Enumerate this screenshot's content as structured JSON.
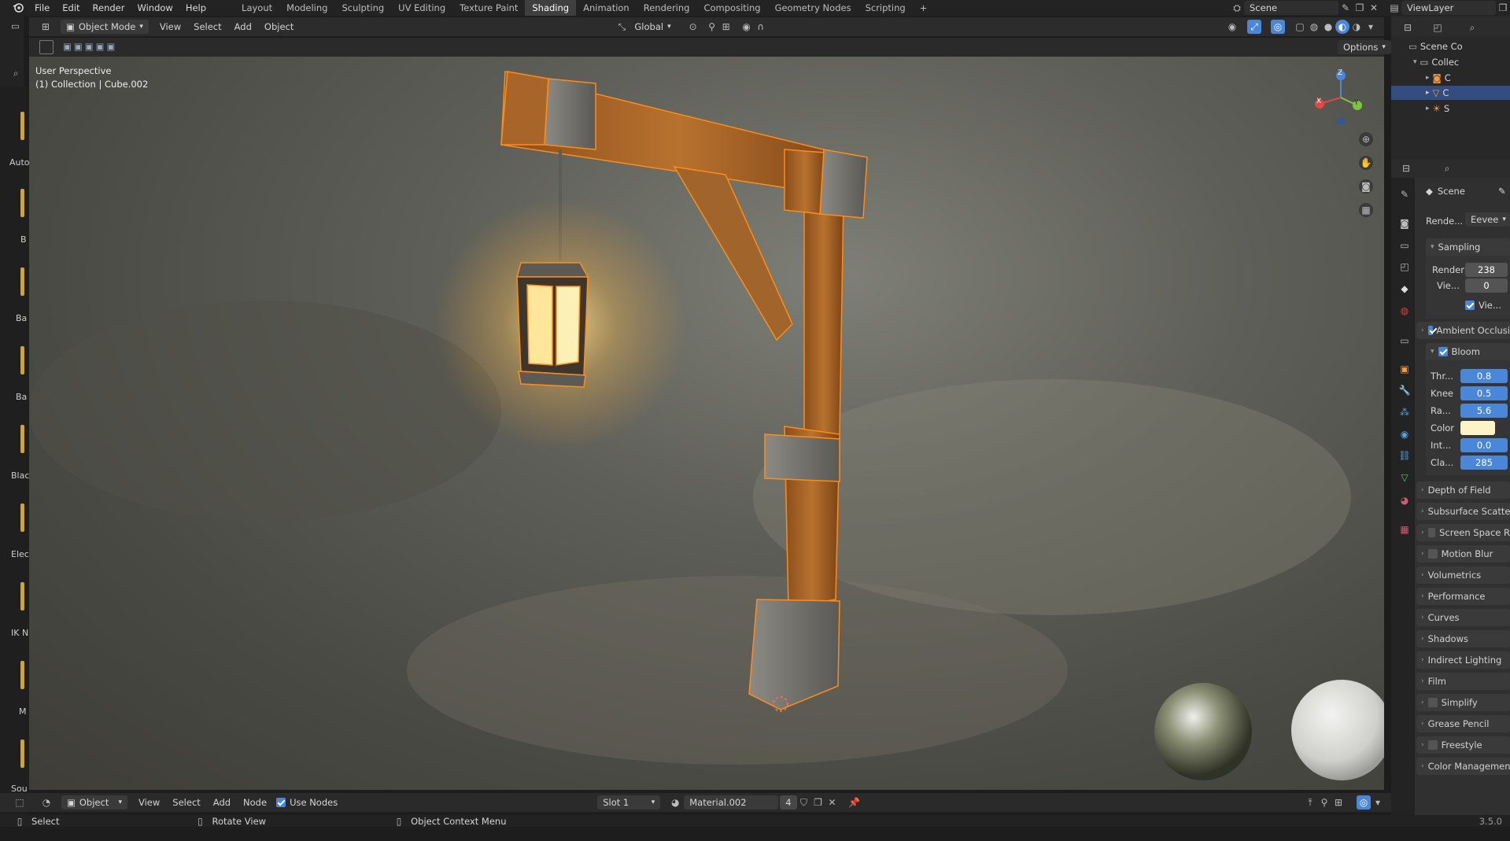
{
  "topbar": {
    "menus": [
      "File",
      "Edit",
      "Render",
      "Window",
      "Help"
    ],
    "workspaces": [
      "Layout",
      "Modeling",
      "Sculpting",
      "UV Editing",
      "Texture Paint",
      "Shading",
      "Animation",
      "Rendering",
      "Compositing",
      "Geometry Nodes",
      "Scripting"
    ],
    "active_workspace": "Shading",
    "plus": "+",
    "scene": "Scene",
    "view_layer": "ViewLayer"
  },
  "viewport_header": {
    "mode": "Object Mode",
    "menus": [
      "View",
      "Select",
      "Add",
      "Object"
    ],
    "orientation": "Global",
    "options": "Options"
  },
  "viewport": {
    "perspective": "User Perspective",
    "collection_info": "(1) Collection | Cube.002",
    "gizmo": {
      "x": "X",
      "y": "Y",
      "z": "Z"
    }
  },
  "left_strip": [
    "Auto",
    "B",
    "Ba",
    "Ba",
    "Blac",
    "Elec",
    "IK N",
    "M",
    "Sou"
  ],
  "outliner": {
    "root": "Scene Co",
    "collection": "Collec",
    "items": [
      "C",
      "C",
      "S"
    ]
  },
  "properties": {
    "scene_label": "Scene",
    "render_engine_label": "Rende...",
    "render_engine": "Eevee",
    "sampling": {
      "title": "Sampling",
      "render_label": "Render",
      "render_value": "238",
      "viewport_label": "Vie...",
      "viewport_value": "0",
      "denoise_label": "Vie..."
    },
    "ambient_occlusion": "Ambient Occlusi",
    "bloom": {
      "title": "Bloom",
      "threshold_label": "Thr...",
      "threshold": "0.8",
      "knee_label": "Knee",
      "knee": "0.5",
      "radius_label": "Ra...",
      "radius": "5.6",
      "color_label": "Color",
      "color": "#fef3c7",
      "intensity_label": "Int...",
      "intensity": "0.0",
      "clamp_label": "Cla...",
      "clamp": "285"
    },
    "panels": [
      "Depth of Field",
      "Subsurface Scatteri",
      "Screen Space R",
      "Motion Blur",
      "Volumetrics",
      "Performance",
      "Curves",
      "Shadows",
      "Indirect Lighting",
      "Film",
      "Simplify",
      "Grease Pencil",
      "Freestyle",
      "Color Management"
    ]
  },
  "node_header": {
    "type": "Object",
    "menus": [
      "View",
      "Select",
      "Add",
      "Node"
    ],
    "use_nodes": "Use Nodes",
    "slot": "Slot 1",
    "material": "Material.002",
    "users": "4"
  },
  "statusbar": {
    "select": "Select",
    "rotate": "Rotate View",
    "context": "Object Context Menu",
    "version": "3.5.0"
  },
  "colors": {
    "accent": "#4b87d8",
    "active_outline": "#ff8c1a",
    "bloom_glow": "#ffd36b"
  }
}
